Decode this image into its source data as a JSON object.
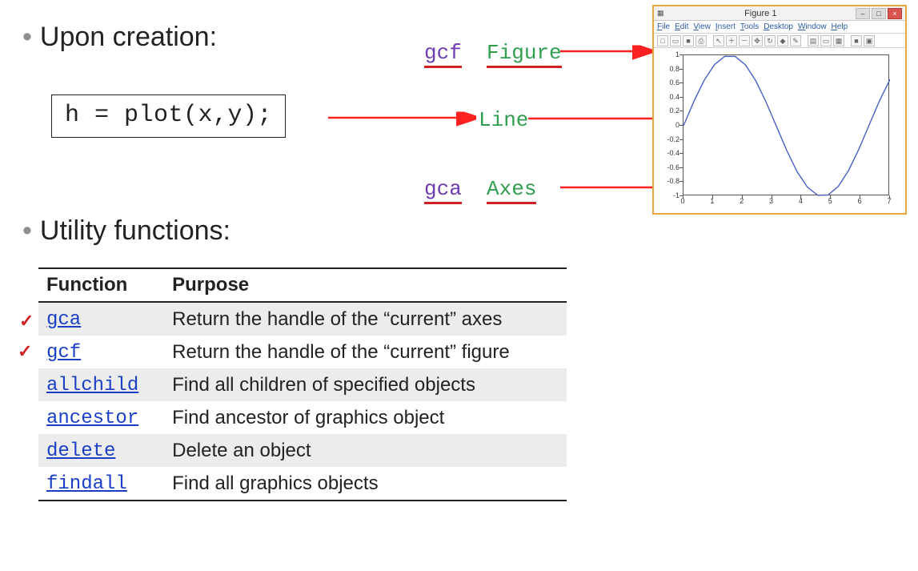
{
  "heading1": "Upon creation:",
  "heading2": "Utility functions:",
  "code": "h = plot(x,y);",
  "annotations": {
    "gcf": "gcf",
    "figure": "Figure",
    "line": "Line",
    "gca": "gca",
    "axes": "Axes"
  },
  "table": {
    "header_fn": "Function",
    "header_purpose": "Purpose",
    "rows": [
      {
        "fn": "gca",
        "purpose": "Return the handle of the “current” axes"
      },
      {
        "fn": "gcf",
        "purpose": "Return the handle of the “current” figure"
      },
      {
        "fn": "allchild",
        "purpose": "Find all children of specified objects"
      },
      {
        "fn": "ancestor",
        "purpose": "Find ancestor of graphics object"
      },
      {
        "fn": "delete",
        "purpose": "Delete an object"
      },
      {
        "fn": "findall",
        "purpose": "Find all graphics objects"
      }
    ]
  },
  "figure_window": {
    "title": "Figure 1",
    "menus": [
      "File",
      "Edit",
      "View",
      "Insert",
      "Tools",
      "Desktop",
      "Window",
      "Help"
    ]
  },
  "chart_data": {
    "type": "line",
    "title": "",
    "xlabel": "",
    "ylabel": "",
    "xlim": [
      0,
      7
    ],
    "ylim": [
      -1,
      1
    ],
    "xticks": [
      0,
      1,
      2,
      3,
      4,
      5,
      6,
      7
    ],
    "yticks": [
      -1,
      -0.8,
      -0.6,
      -0.4,
      -0.2,
      0,
      0.2,
      0.4,
      0.6,
      0.8,
      1
    ],
    "x": [
      0.0,
      0.35,
      0.7,
      1.05,
      1.4,
      1.75,
      2.1,
      2.45,
      2.8,
      3.15,
      3.5,
      3.85,
      4.2,
      4.55,
      4.9,
      5.25,
      5.6,
      5.95,
      6.3,
      6.65,
      7.0
    ],
    "y": [
      0.0,
      0.3429,
      0.6442,
      0.8674,
      0.9854,
      0.9839,
      0.8632,
      0.6378,
      0.335,
      -0.0084,
      -0.3508,
      -0.6506,
      -0.8716,
      -0.9868,
      -0.9825,
      -0.8589,
      -0.6313,
      -0.3271,
      0.0168,
      0.3586,
      0.657
    ]
  }
}
